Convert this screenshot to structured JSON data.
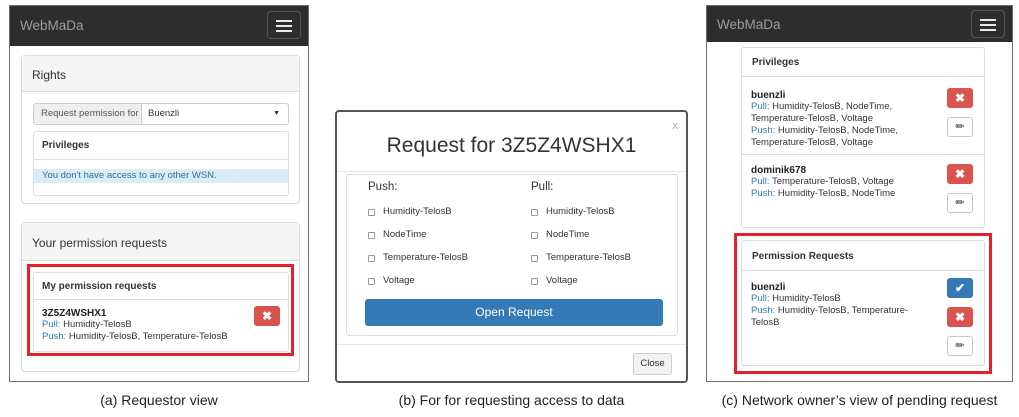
{
  "panel_a": {
    "brand": "WebMaDa",
    "rights_title": "Rights",
    "request_permission_for": "Request permission for",
    "select_value": "Buenzli",
    "privileges_title": "Privileges",
    "no_access_message": "You don't have access to any other WSN.",
    "your_requests_title": "Your permission requests",
    "my_requests_title": "My permission requests",
    "request": {
      "id": "3Z5Z4WSHX1",
      "pull_label": "Pull:",
      "pull_value": " Humidity-TelosB",
      "push_label": "Push:",
      "push_value": " Humidity-TelosB, Temperature-TelosB"
    },
    "delete_glyph": "✖"
  },
  "panel_b": {
    "close_x": "x",
    "title": "Request for 3Z5Z4WSHX1",
    "push_header": "Push:",
    "pull_header": "Pull:",
    "push_options": [
      "Humidity-TelosB",
      "NodeTime",
      "Temperature-TelosB",
      "Voltage"
    ],
    "pull_options": [
      "Humidity-TelosB",
      "NodeTime",
      "Temperature-TelosB",
      "Voltage"
    ],
    "open_request_button": "Open Request",
    "close_button": "Close"
  },
  "panel_c": {
    "brand": "WebMaDa",
    "privileges_title": "Privileges",
    "users": [
      {
        "name": "buenzli",
        "pull_label": "Pull:",
        "pull_value": " Humidity-TelosB, NodeTime,",
        "pull_value_2": "Temperature-TelosB, Voltage",
        "push_label": "Push:",
        "push_value": " Humidity-TelosB, NodeTime,",
        "push_value_2": "Temperature-TelosB, Voltage"
      },
      {
        "name": "dominik678",
        "pull_label": "Pull:",
        "pull_value": " Temperature-TelosB, Voltage",
        "push_label": "Push:",
        "push_value": " Humidity-TelosB, NodeTime"
      }
    ],
    "permission_requests_title": "Permission Requests",
    "request": {
      "name": "buenzli",
      "pull_label": "Pull:",
      "pull_value": " Humidity-TelosB",
      "push_label": "Push:",
      "push_value": " Humidity-TelosB, Temperature-",
      "push_value_2": "TelosB"
    },
    "delete_glyph": "✖",
    "accept_glyph": "✔",
    "edit_glyph": "✏"
  },
  "captions": {
    "a": "(a) Requestor view",
    "b": "(b) For for requesting access to data",
    "c": "(c) Network owner’s view of pending request"
  },
  "colors": {
    "navbar": "#2d2d2d",
    "highlight_red": "#e4202a",
    "primary_blue": "#337ab7",
    "danger_red": "#d9534f",
    "info_bg": "#d9edf7"
  }
}
